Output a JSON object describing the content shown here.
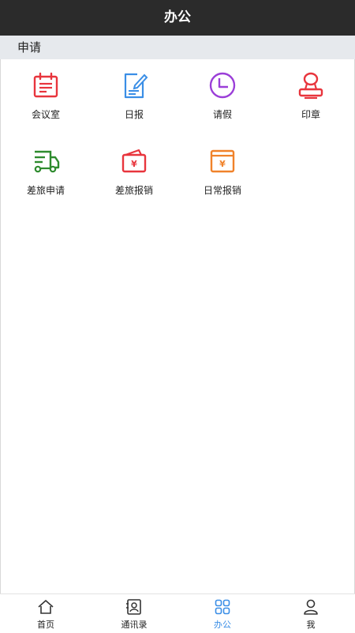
{
  "header": {
    "title": "办公"
  },
  "section": {
    "title": "申请"
  },
  "tiles": [
    {
      "label": "会议室",
      "icon": "calendar-icon",
      "color": "#e8353d"
    },
    {
      "label": "日报",
      "icon": "edit-document-icon",
      "color": "#3a8ee6"
    },
    {
      "label": "请假",
      "icon": "clock-icon",
      "color": "#9b3fd8"
    },
    {
      "label": "印章",
      "icon": "seal-stamp-icon",
      "color": "#e8353d"
    },
    {
      "label": "差旅申请",
      "icon": "truck-icon",
      "color": "#2e8b2e"
    },
    {
      "label": "差旅报销",
      "icon": "wallet-yuan-icon",
      "color": "#e8353d"
    },
    {
      "label": "日常报销",
      "icon": "yuan-box-icon",
      "color": "#f0822a"
    }
  ],
  "nav": [
    {
      "label": "首页",
      "icon": "home-icon",
      "active": false
    },
    {
      "label": "通讯录",
      "icon": "contacts-icon",
      "active": false
    },
    {
      "label": "办公",
      "icon": "grid-icon",
      "active": true
    },
    {
      "label": "我",
      "icon": "user-icon",
      "active": false
    }
  ],
  "colors": {
    "header_bg": "#2b2b2b",
    "section_bg": "#e6e9ed",
    "accent": "#3a8ee6"
  }
}
